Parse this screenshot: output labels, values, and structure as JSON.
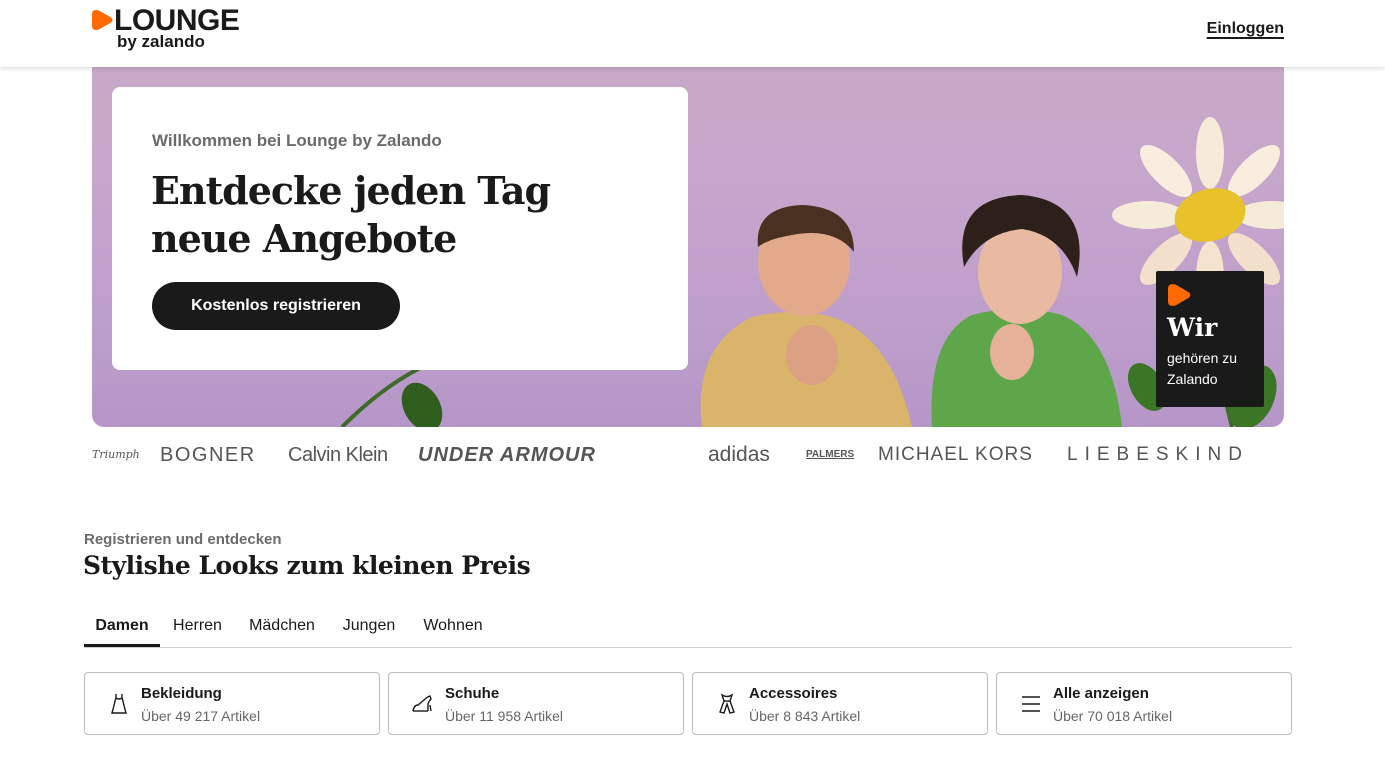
{
  "header": {
    "logo_word": "LOUNGE",
    "logo_sub": "by zalando",
    "login_label": "Einloggen"
  },
  "hero": {
    "eyebrow": "Willkommen bei Lounge by Zalando",
    "title": "Entdecke jeden Tag neue Angebote",
    "cta_label": "Kostenlos registrieren",
    "badge_title": "Wir",
    "badge_sub": "gehören zu Zalando"
  },
  "brands": [
    "Triumph",
    "BOGNER",
    "Calvin Klein",
    "UNDER ARMOUR",
    "adidas",
    "PALMERS",
    "MICHAEL KORS",
    "LIEBESKIND"
  ],
  "section": {
    "eyebrow": "Registrieren und entdecken",
    "title": "Stylishe Looks zum kleinen Preis",
    "tabs": [
      {
        "label": "Damen",
        "active": true
      },
      {
        "label": "Herren",
        "active": false
      },
      {
        "label": "Mädchen",
        "active": false
      },
      {
        "label": "Jungen",
        "active": false
      },
      {
        "label": "Wohnen",
        "active": false
      }
    ],
    "categories": [
      {
        "title": "Bekleidung",
        "count": "Über 49 217 Artikel",
        "icon": "dress-icon"
      },
      {
        "title": "Schuhe",
        "count": "Über 11 958 Artikel",
        "icon": "shoe-icon"
      },
      {
        "title": "Accessoires",
        "count": "Über 8 843 Artikel",
        "icon": "scarf-icon"
      },
      {
        "title": "Alle anzeigen",
        "count": "Über 70 018 Artikel",
        "icon": "list-icon"
      }
    ]
  },
  "colors": {
    "brand_orange": "#ff6900",
    "text": "#1a1a1a",
    "hero_bg": "#c4a4cc"
  }
}
